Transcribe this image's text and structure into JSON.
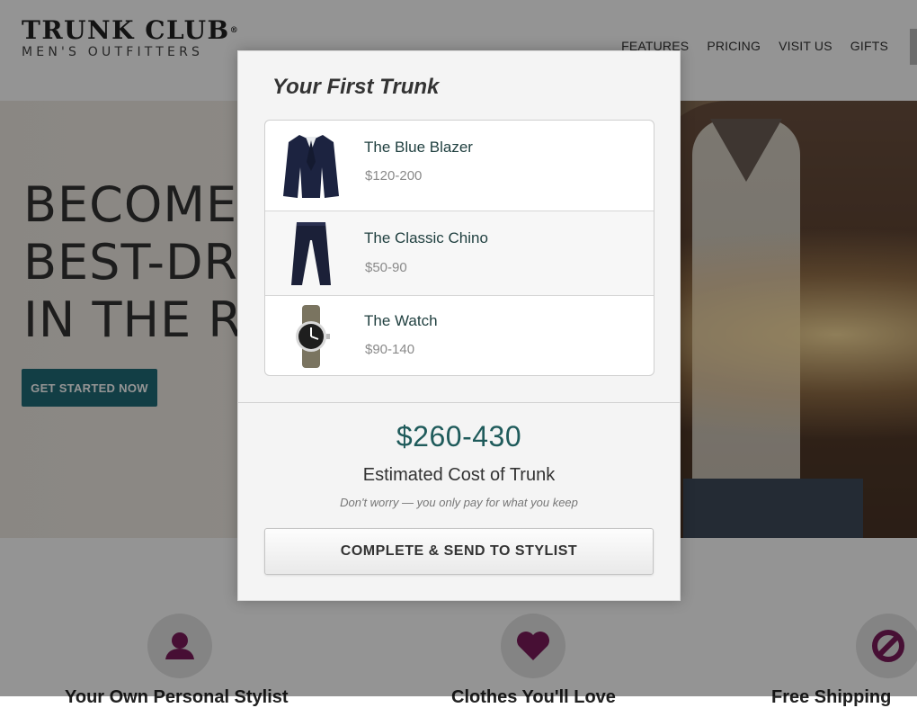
{
  "header": {
    "logo_title": "TRUNK CLUB",
    "logo_reg": "®",
    "logo_subtitle": "MEN'S OUTFITTERS",
    "nav": [
      "FEATURES",
      "PRICING",
      "VISIT US",
      "GIFTS"
    ]
  },
  "hero": {
    "title_lines": [
      "BECOME THE",
      "BEST-DRESSED MAN",
      "IN THE ROOM"
    ],
    "cta_label": "GET STARTED NOW"
  },
  "features": {
    "icons": [
      "person-icon",
      "heart-icon",
      "no-sign-icon"
    ],
    "labels": [
      "Your Own Personal Stylist",
      "Clothes You'll Love",
      "Free Shipping"
    ]
  },
  "modal": {
    "title": "Your First Trunk",
    "items": [
      {
        "name": "The Blue Blazer",
        "price": "$120-200",
        "icon": "blazer-icon"
      },
      {
        "name": "The Classic Chino",
        "price": "$50-90",
        "icon": "chino-icon"
      },
      {
        "name": "The Watch",
        "price": "$90-140",
        "icon": "watch-icon"
      }
    ],
    "total": "$260-430",
    "total_label": "Estimated Cost of Trunk",
    "note": "Don't worry — you only pay for what you keep",
    "submit_label": "COMPLETE & SEND TO STYLIST"
  },
  "colors": {
    "accent_teal": "#1f6c78",
    "feature_icon": "#7a1a5a"
  }
}
